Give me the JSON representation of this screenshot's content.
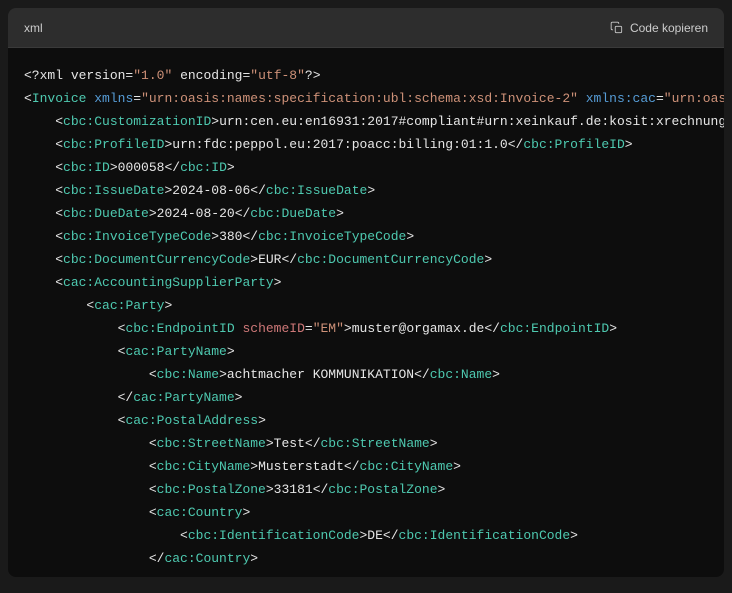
{
  "header": {
    "language": "xml",
    "copy_label": "Code kopieren"
  },
  "xml": {
    "pi_open": "<?xml ",
    "pi_version_attr": "version",
    "pi_version_val": "\"1.0\"",
    "pi_encoding_attr": "encoding",
    "pi_encoding_val": "\"utf-8\"",
    "pi_close": "?>",
    "invoice_tag": "Invoice",
    "xmlns_attr": "xmlns",
    "xmlns_val": "\"urn:oasis:names:specification:ubl:schema:xsd:Invoice-2\"",
    "xmlns_cac_attr": "xmlns:cac",
    "xmlns_cac_val": "\"urn:oas",
    "customization_tag": "cbc:CustomizationID",
    "customization_text": "urn:cen.eu:en16931:2017#compliant#urn:xeinkauf.de:kosit:xrechnung",
    "profileid_tag": "cbc:ProfileID",
    "profileid_text": "urn:fdc:peppol.eu:2017:poacc:billing:01:1.0",
    "id_tag": "cbc:ID",
    "id_text": "000058",
    "issuedate_tag": "cbc:IssueDate",
    "issuedate_text": "2024-08-06",
    "duedate_tag": "cbc:DueDate",
    "duedate_text": "2024-08-20",
    "invoicetype_tag": "cbc:InvoiceTypeCode",
    "invoicetype_text": "380",
    "currency_tag": "cbc:DocumentCurrencyCode",
    "currency_text": "EUR",
    "supplier_tag": "cac:AccountingSupplierParty",
    "party_tag": "cac:Party",
    "endpoint_tag": "cbc:EndpointID",
    "schemeid_attr": "schemeID",
    "schemeid_val": "\"EM\"",
    "endpoint_text": "muster@orgamax.de",
    "partyname_tag": "cac:PartyName",
    "name_tag": "cbc:Name",
    "name_text": "achtmacher KOMMUNIKATION",
    "postal_tag": "cac:PostalAddress",
    "street_tag": "cbc:StreetName",
    "street_text": "Test",
    "city_tag": "cbc:CityName",
    "city_text": "Musterstadt",
    "zone_tag": "cbc:PostalZone",
    "zone_text": "33181",
    "country_tag": "cac:Country",
    "idcode_tag": "cbc:IdentificationCode",
    "idcode_text": "DE"
  }
}
